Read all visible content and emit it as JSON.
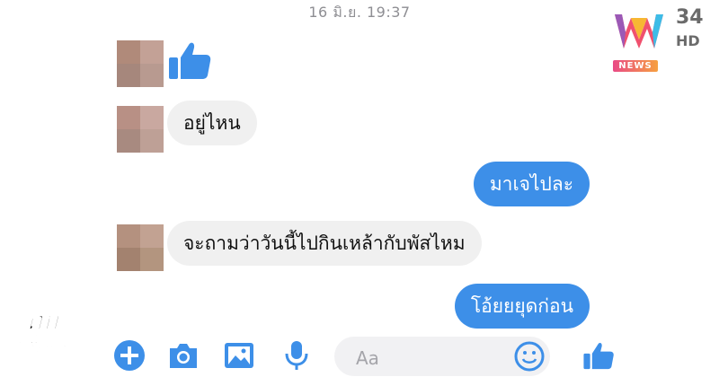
{
  "header": {
    "timestamp": "16 มิ.ย. 19:37"
  },
  "channel": {
    "number": "34",
    "hd": "HD",
    "news": "NEWS"
  },
  "watermark": {
    "line1": "ทุบ",
    "line2": "โต๊ะข่าว"
  },
  "messages": [
    {
      "side": "in",
      "type": "like"
    },
    {
      "side": "in",
      "text": "อยู่ไหน"
    },
    {
      "side": "out",
      "text": "มาเจไปละ"
    },
    {
      "side": "in",
      "text": "จะถามว่าวันนี้ไปกินเหล้ากับพัสไหม"
    },
    {
      "side": "out",
      "text": "โอ้ยยยุดก่อน"
    }
  ],
  "composer": {
    "placeholder": "Aa",
    "icons": [
      "add-icon",
      "camera-icon",
      "image-icon",
      "microphone-icon",
      "emoji-icon",
      "like-icon"
    ]
  },
  "colors": {
    "accent": "#3d8fe8",
    "bubble_in": "#f0f0f0"
  }
}
